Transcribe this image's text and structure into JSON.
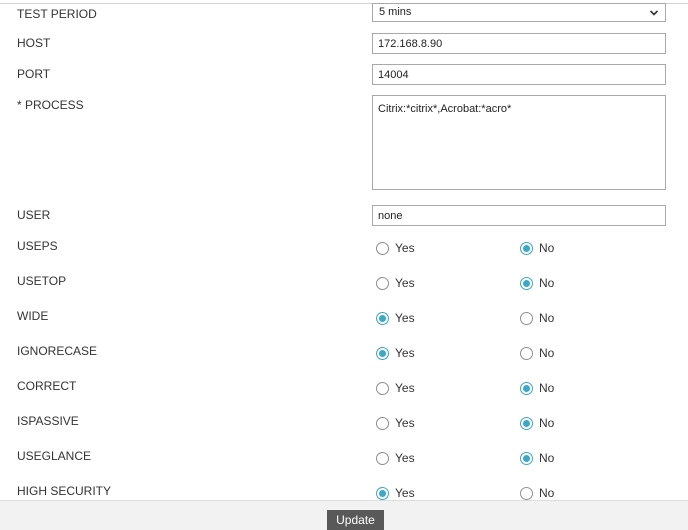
{
  "form": {
    "test_period": {
      "label": "TEST PERIOD",
      "value": "5 mins"
    },
    "host": {
      "label": "HOST",
      "value": "172.168.8.90"
    },
    "port": {
      "label": "PORT",
      "value": "14004"
    },
    "process": {
      "label": "* PROCESS",
      "value": "Citrix:*citrix*,Acrobat:*acro*"
    },
    "user": {
      "label": "USER",
      "value": "none"
    },
    "radios": [
      {
        "label": "USEPS",
        "selected": "No"
      },
      {
        "label": "USETOP",
        "selected": "No"
      },
      {
        "label": "WIDE",
        "selected": "Yes"
      },
      {
        "label": "IGNORECASE",
        "selected": "Yes"
      },
      {
        "label": "CORRECT",
        "selected": "No"
      },
      {
        "label": "ISPASSIVE",
        "selected": "No"
      },
      {
        "label": "USEGLANCE",
        "selected": "No"
      },
      {
        "label": "HIGH SECURITY",
        "selected": "Yes"
      }
    ],
    "yes_label": "Yes",
    "no_label": "No"
  },
  "footer": {
    "update_label": "Update"
  },
  "colors": {
    "accent": "#3ca8c7",
    "button_bg": "#595959",
    "footer_bg": "#f2f2f2"
  },
  "icons": {
    "select_arrow": "chevron-down-icon"
  }
}
